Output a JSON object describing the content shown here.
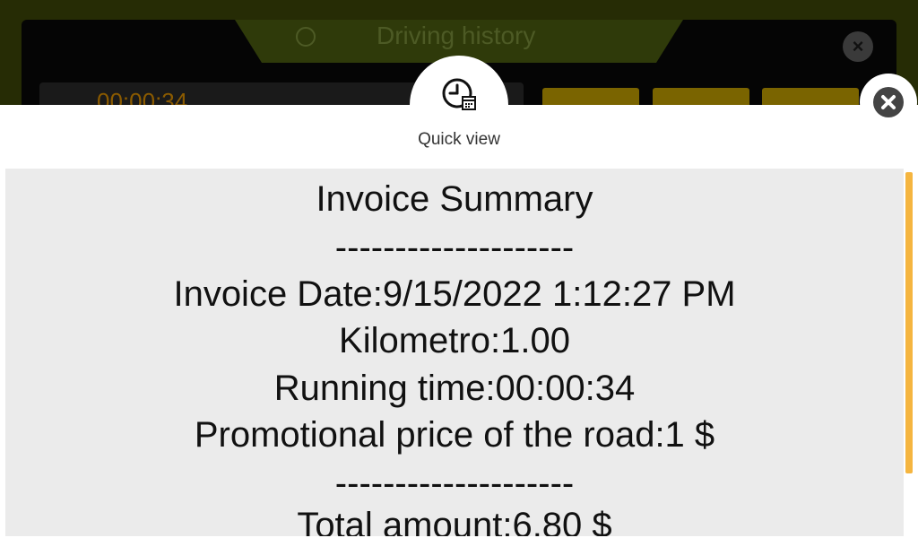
{
  "background_app": {
    "title": "Driving history",
    "timer": "00:00:34"
  },
  "quick_view": {
    "tab_label": "Quick view"
  },
  "invoice": {
    "title": "Invoice Summary",
    "separator_1": "--------------------",
    "date_line": "Invoice Date:9/15/2022 1:12:27 PM",
    "km_line": "Kilometro:1.00",
    "running_time_line": "Running time:00:00:34",
    "promo_line": "Promotional price of the road:1 $",
    "separator_2": "--------------------",
    "total_line": "Total amount:6.80 $"
  },
  "colors": {
    "accent": "#f5b53f",
    "content_bg": "#ebebeb",
    "bg_app": "#262c05"
  }
}
